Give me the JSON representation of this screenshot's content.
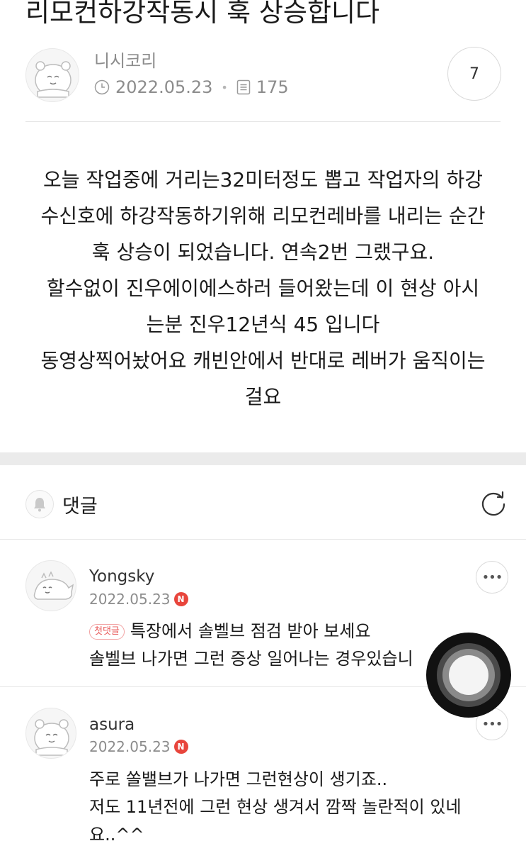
{
  "post": {
    "title": "리모컨하강작동시 훅 상승합니다",
    "author": "니시코리",
    "date": "2022.05.23",
    "views": "175",
    "comment_count": "7",
    "body_lines": [
      "오늘 작업중에 거리는32미터정도 뽑고 작업자의 하강",
      "수신호에 하강작동하기위해 리모컨레바를 내리는 순간",
      "훅 상승이 되었습니다. 연속2번 그랬구요.",
      " 할수없이 진우에이에스하러 들어왔는데  이 현상 아시",
      "는분 진우12년식 45 입니다",
      "동영상찍어놨어요 캐빈안에서 반대로 레버가 움직이는",
      "걸요"
    ]
  },
  "comments_section": {
    "title": "댓글",
    "icons": {
      "bell": "bell-icon",
      "refresh": "refresh-icon"
    }
  },
  "comments": [
    {
      "author": "Yongsky",
      "date": "2022.05.23",
      "badge": "N",
      "tag": "첫댓글",
      "lines": [
        "특장에서 솔벨브 점검 받아 보세요",
        "솔벨브 나가면 그런 증상 일어나는 경우있습니"
      ],
      "more": "•••"
    },
    {
      "author": "asura",
      "date": "2022.05.23",
      "badge": "N",
      "lines": [
        "주로 쏠밸브가 나가면 그런현상이 생기죠..",
        "저도 11년전에 그런 현상 생겨서 깜짝 놀란적이 있네",
        "요..^^"
      ],
      "more": "•••"
    }
  ],
  "colors": {
    "badge": "#e8453c",
    "first_tag": "#e85a5a",
    "meta_text": "#8c8c8c"
  }
}
